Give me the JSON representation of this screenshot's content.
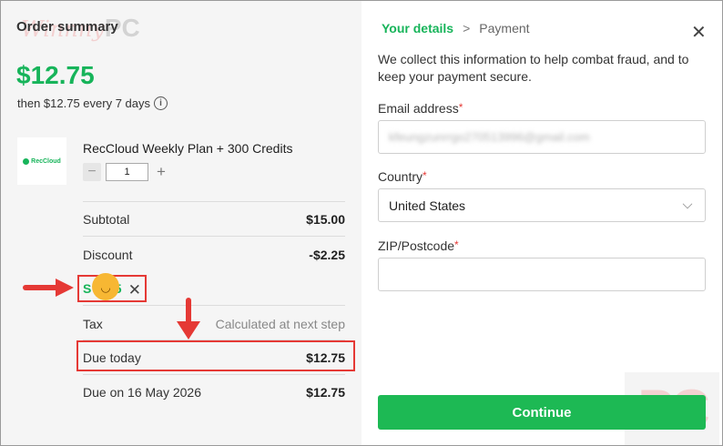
{
  "order": {
    "title": "Order summary",
    "price": "$12.75",
    "price_sub": "then $12.75 every 7 days",
    "watermark": "Winnny",
    "watermark_pc": "PC",
    "logo_text": "RecCloud",
    "product_name": "RecCloud Weekly Plan + 300 Credits",
    "quantity": "1",
    "rows": {
      "subtotal": {
        "label": "Subtotal",
        "value": "$15.00"
      },
      "discount": {
        "label": "Discount",
        "value": "-$2.25"
      },
      "tax": {
        "label": "Tax",
        "value": "Calculated at next step"
      },
      "due_today": {
        "label": "Due today",
        "value": "$12.75"
      },
      "due_on": {
        "label": "Due on 16 May 2026",
        "value": "$12.75"
      }
    },
    "coupon_prefix": "S",
    "coupon_suffix": "5"
  },
  "checkout": {
    "breadcrumb": {
      "step1": "Your details",
      "sep": ">",
      "step2": "Payment"
    },
    "description": "We collect this information to help combat fraud, and to keep your payment secure.",
    "email_label": "Email address",
    "email_value": "kfeungzunrrgo270513996@gmail.com",
    "country_label": "Country",
    "country_value": "United States",
    "zip_label": "ZIP/Postcode",
    "zip_value": "",
    "required_mark": "*",
    "continue_label": "Continue",
    "corner_mark": "PC"
  },
  "colors": {
    "accent_green": "#17b45a",
    "button_green": "#1db954",
    "annotation_red": "#e53935"
  }
}
